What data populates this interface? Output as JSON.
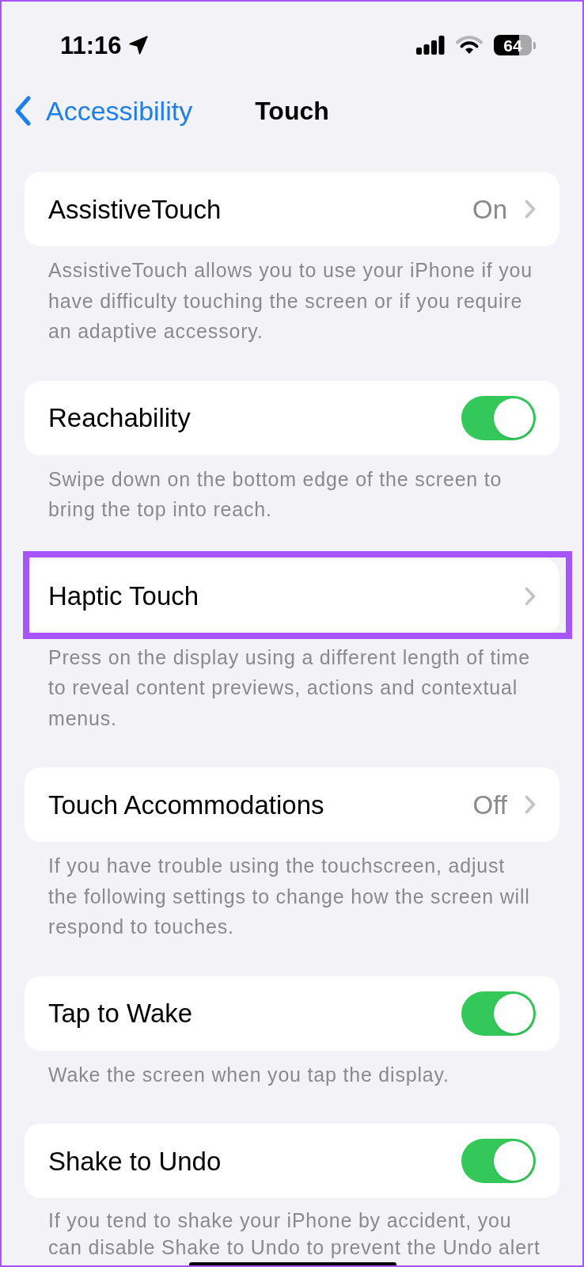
{
  "status_bar": {
    "time": "11:16",
    "battery": "64"
  },
  "nav": {
    "back": "Accessibility",
    "title": "Touch"
  },
  "sections": [
    {
      "kind": "link",
      "label": "AssistiveTouch",
      "value": "On",
      "highlighted": false,
      "footer": "AssistiveTouch allows you to use your iPhone if you have difficulty touching the screen or if you require an adaptive accessory."
    },
    {
      "kind": "toggle",
      "label": "Reachability",
      "on": true,
      "highlighted": false,
      "footer": "Swipe down on the bottom edge of the screen to bring the top into reach."
    },
    {
      "kind": "link",
      "label": "Haptic Touch",
      "highlighted": true,
      "footer": "Press on the display using a different length of time to reveal content previews, actions and contextual menus."
    },
    {
      "kind": "link",
      "label": "Touch Accommodations",
      "value": "Off",
      "highlighted": false,
      "footer": "If you have trouble using the touchscreen, adjust the following settings to change how the screen will respond to touches."
    },
    {
      "kind": "toggle",
      "label": "Tap to Wake",
      "on": true,
      "highlighted": false,
      "footer": "Wake the screen when you tap the display."
    },
    {
      "kind": "toggle",
      "label": "Shake to Undo",
      "on": true,
      "highlighted": false,
      "footer": "If you tend to shake your iPhone by accident, you can disable Shake to Undo to prevent the Undo alert"
    }
  ]
}
